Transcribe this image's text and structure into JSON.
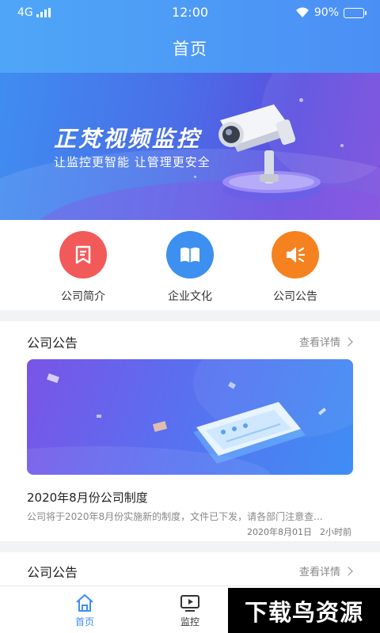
{
  "status_bar": {
    "network": "4G",
    "time": "12:00",
    "battery": "90%",
    "battery_level": 0.9
  },
  "header": {
    "title": "首页"
  },
  "banner": {
    "title": "正梵视频监控",
    "subtitle": "让监控更智能  让管理更安全"
  },
  "quick_menu": [
    {
      "label": "公司简介",
      "icon": "document-icon",
      "color": "#f25a5a"
    },
    {
      "label": "企业文化",
      "icon": "book-icon",
      "color": "#3d8ff0"
    },
    {
      "label": "公司公告",
      "icon": "speaker-icon",
      "color": "#f5821f"
    }
  ],
  "sections": [
    {
      "title": "公司公告",
      "more_label": "查看详情",
      "news": {
        "title": "2020年8月份公司制度",
        "desc": "公司将于2020年8月份实施新的制度，文件已下发，请各部门注意查...",
        "date": "2020年8月01日",
        "ago": "2小时前"
      }
    },
    {
      "title": "公司公告",
      "more_label": "查看详情"
    }
  ],
  "bottom_nav": [
    {
      "label": "首页",
      "icon": "home-icon",
      "active": true
    },
    {
      "label": "监控",
      "icon": "video-icon",
      "active": false
    }
  ],
  "watermark": "下载鸟资源",
  "colors": {
    "accent": "#3d8ff0",
    "header_bg": "#4b9af6"
  }
}
